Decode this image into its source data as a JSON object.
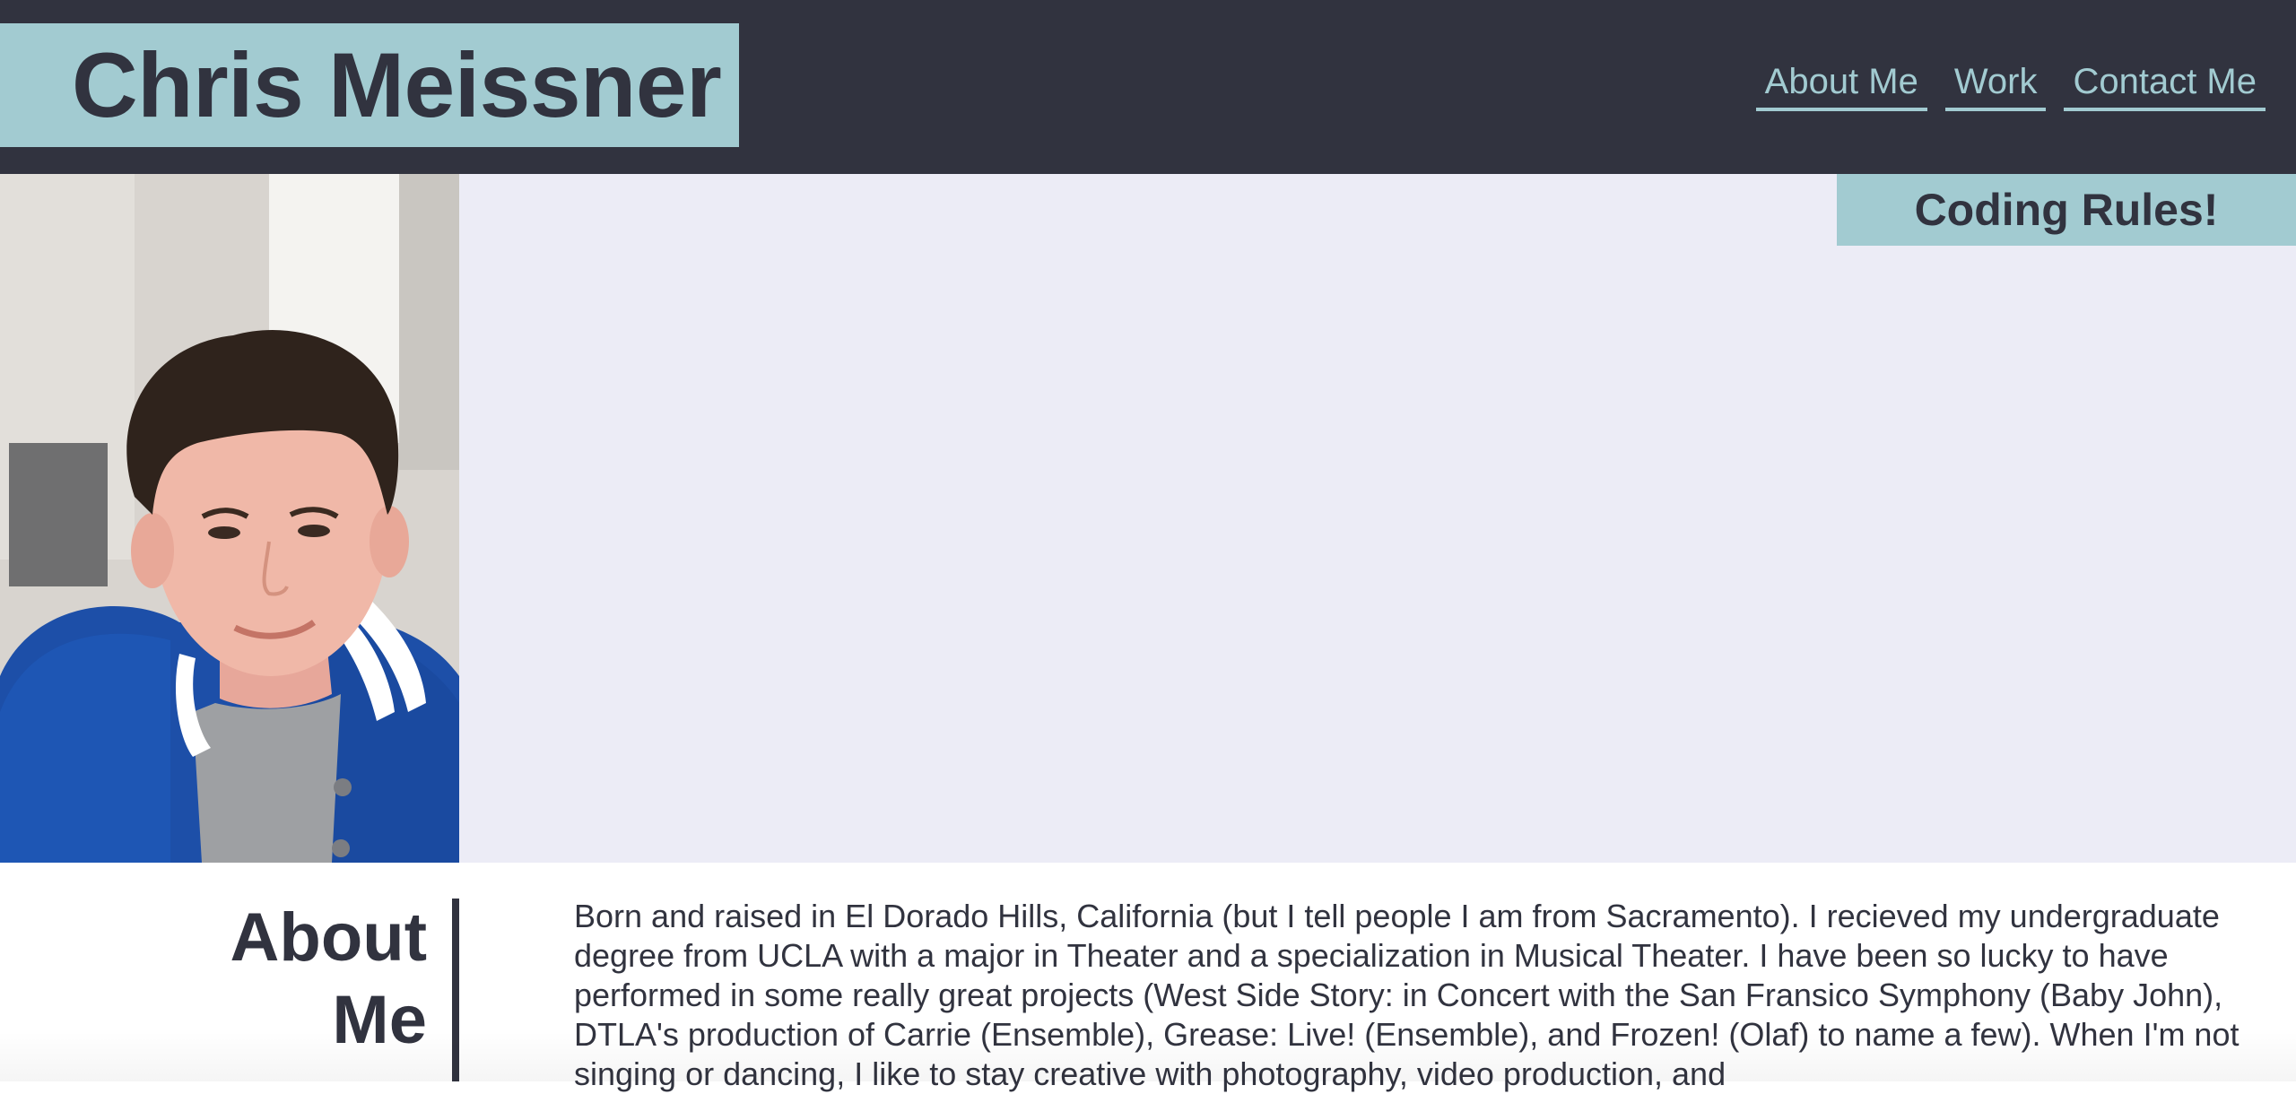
{
  "header": {
    "brand_name": "Chris Meissner",
    "nav": [
      {
        "label": "About Me"
      },
      {
        "label": "Work"
      },
      {
        "label": "Contact Me"
      }
    ]
  },
  "hero": {
    "badge": "Coding Rules!",
    "portrait_description": "portrait-photo"
  },
  "about": {
    "heading_line1": "About",
    "heading_line2": "Me",
    "body": "Born and raised in El Dorado Hills, California (but I tell people I am from Sacramento). I recieved my undergraduate degree from UCLA with a major in Theater and a specialization in Musical Theater. I have been so lucky to have performed in some really great projects (West Side Story: in Concert with the San Fransico Symphony (Baby John), DTLA's production of Carrie (Ensemble), Grease: Live! (Ensemble), and Frozen! (Olaf) to name a few). When I'm not singing or dancing, I like to stay creative with photography, video production, and"
  },
  "colors": {
    "header_bg": "#31333f",
    "accent": "#a2cbd1",
    "hero_bg": "#ececf6",
    "text": "#31333f"
  }
}
